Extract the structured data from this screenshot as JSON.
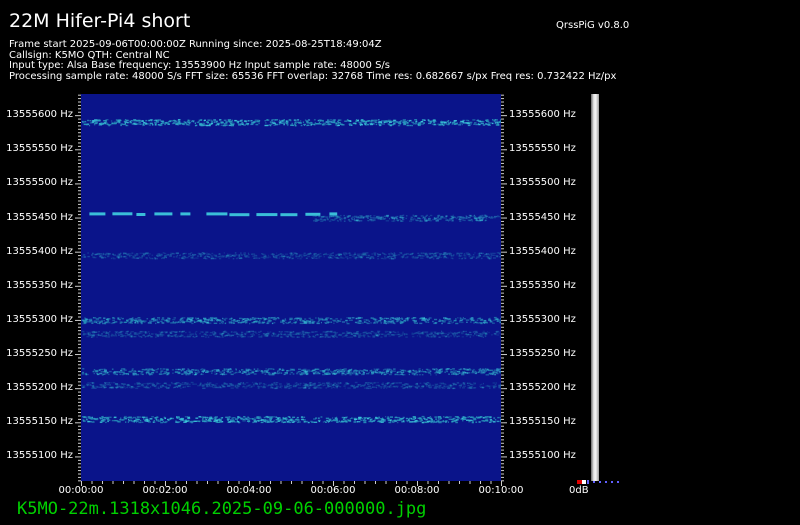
{
  "header": {
    "title": "22M Hifer-Pi4 short",
    "version": "QrssPiG v0.8.0"
  },
  "info_lines": [
    "Frame start 2025-09-06T00:00:00Z Running since: 2025-08-25T18:49:04Z",
    "Callsign: K5MO QTH: Central NC",
    "Input type: Alsa Base frequency: 13553900 Hz Input sample rate: 48000 S/s",
    "Processing sample rate: 48000 S/s FFT size: 65536 FFT overlap: 32768 Time res: 0.682667 s/px Freq res: 0.732422 Hz/px"
  ],
  "frequency_axis": {
    "labels": [
      "13555600 Hz",
      "13555550 Hz",
      "13555500 Hz",
      "13555450 Hz",
      "13555400 Hz",
      "13555350 Hz",
      "13555300 Hz",
      "13555250 Hz",
      "13555200 Hz",
      "13555150 Hz",
      "13555100 Hz"
    ],
    "values": [
      13555600,
      13555550,
      13555500,
      13555450,
      13555400,
      13555350,
      13555300,
      13555250,
      13555200,
      13555150,
      13555100
    ],
    "max": 13555631,
    "min": 13555064
  },
  "time_axis": {
    "labels": [
      "00:00:00",
      "00:02:00",
      "00:04:00",
      "00:06:00",
      "00:08:00",
      "00:10:00"
    ],
    "minutes": [
      0,
      2,
      4,
      6,
      8,
      10
    ],
    "max_minutes": 10
  },
  "db_label": "0dB",
  "filename": "K5MO-22m.1318x1046.2025-09-06-000000.jpg",
  "colors": {
    "waterfall_bg": "#0a148a",
    "signal": "#2a9fc0",
    "signal_strong": "#3fd0e0",
    "filename_green": "#00d000"
  },
  "signals": [
    {
      "name": "band-13555590",
      "freq": 13555590,
      "t0": 0,
      "t1": 10,
      "strength": "strong"
    },
    {
      "name": "morse-13555455",
      "freq": 13555455,
      "t0": 0.2,
      "t1": 6.1,
      "strength": "strong",
      "pattern": "morse"
    },
    {
      "name": "band-13555450",
      "freq": 13555450,
      "t0": 5.5,
      "t1": 10,
      "strength": "weak"
    },
    {
      "name": "band-13555395",
      "freq": 13555395,
      "t0": 0,
      "t1": 10,
      "strength": "faint"
    },
    {
      "name": "band-13555300",
      "freq": 13555300,
      "t0": 0,
      "t1": 10,
      "strength": "medium"
    },
    {
      "name": "band-13555280",
      "freq": 13555280,
      "t0": 0,
      "t1": 10,
      "strength": "faint"
    },
    {
      "name": "band-13555225",
      "freq": 13555225,
      "t0": 0,
      "t1": 10,
      "strength": "medium"
    },
    {
      "name": "band-13555205",
      "freq": 13555205,
      "t0": 0,
      "t1": 10,
      "strength": "faint"
    },
    {
      "name": "band-13555155",
      "freq": 13555155,
      "t0": 0,
      "t1": 10,
      "strength": "strong"
    }
  ]
}
